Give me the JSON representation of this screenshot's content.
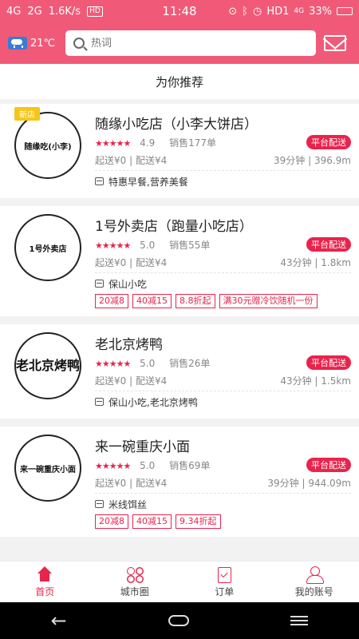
{
  "status_bar": {
    "network1": "4G",
    "network2": "2G",
    "speed": "1.6K/s",
    "hd_box": "HD",
    "time": "11:48",
    "hd1": "HD1",
    "lte": "4G",
    "battery": "33%"
  },
  "header": {
    "temperature": "21℃",
    "search_placeholder": "热词"
  },
  "section_title": "为你推荐",
  "shops": [
    {
      "logo_text": "随缘吃(小李)",
      "tag": "新店",
      "name": "随缘小吃店（小李大饼店）",
      "stars": "★★★★★",
      "score": "4.9",
      "sales": "销售177单",
      "badge": "平台配送",
      "delivery": "起送¥0 | 配送¥4",
      "time_distance": "39分钟 | 396.9m",
      "categories": "特惠早餐,营养美餐",
      "promos": []
    },
    {
      "logo_text": "1号外卖店",
      "name": "1号外卖店（跑量小吃店）",
      "stars": "★★★★★",
      "score": "5.0",
      "sales": "销售55单",
      "badge": "平台配送",
      "delivery": "起送¥0 | 配送¥4",
      "time_distance": "43分钟 | 1.8km",
      "categories": "保山小吃",
      "promos": [
        "20减8",
        "40减15",
        "8.8折起",
        "满30元赠冷饮随机一份"
      ]
    },
    {
      "logo_text": "老北京烤鸭",
      "name": "老北京烤鸭",
      "stars": "★★★★★",
      "score": "5.0",
      "sales": "销售26单",
      "badge": "平台配送",
      "delivery": "起送¥0 | 配送¥4",
      "time_distance": "43分钟 | 1.5km",
      "categories": "保山小吃,老北京烤鸭",
      "promos": []
    },
    {
      "logo_text": "来一碗重庆小面",
      "name": "来一碗重庆小面",
      "stars": "★★★★★",
      "score": "5.0",
      "sales": "销售69单",
      "badge": "平台配送",
      "delivery": "起送¥0 | 配送¥4",
      "time_distance": "39分钟 | 944.09m",
      "categories": "米线饵丝",
      "promos": [
        "20减8",
        "40减15",
        "9.34折起"
      ]
    }
  ],
  "bottom_nav": {
    "home": "首页",
    "city": "城市圈",
    "orders": "订单",
    "account": "我的账号"
  },
  "colors": {
    "brand": "#f05a78",
    "accent": "#e8244c"
  }
}
